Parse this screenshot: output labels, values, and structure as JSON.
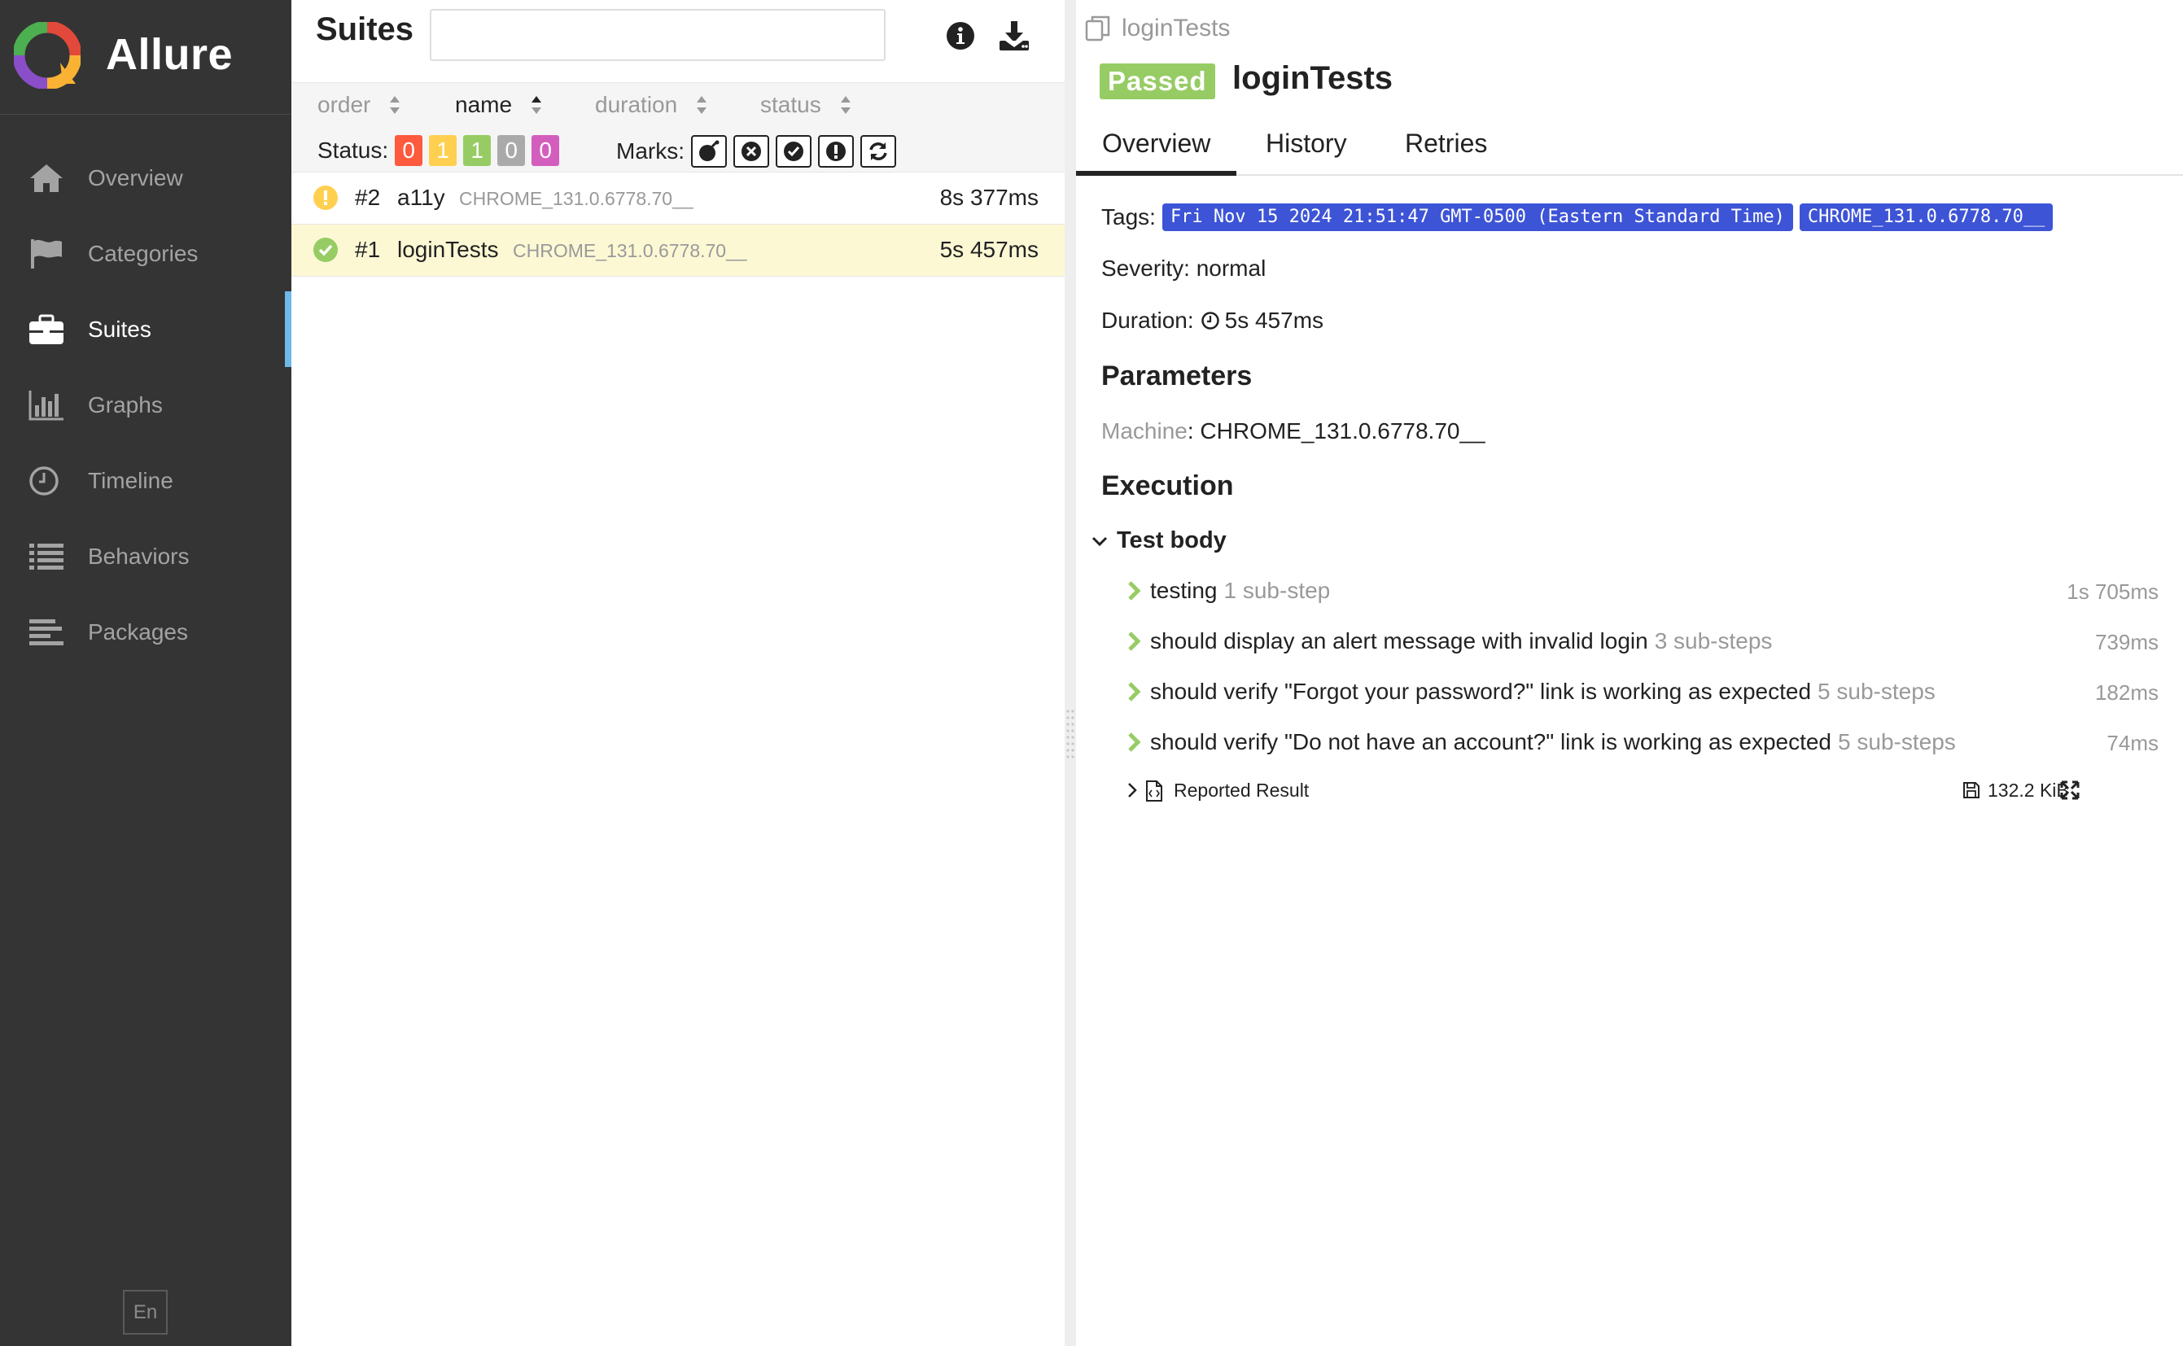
{
  "app": {
    "name": "Allure"
  },
  "sidebar": {
    "items": [
      {
        "label": "Overview",
        "icon": "home-icon"
      },
      {
        "label": "Categories",
        "icon": "flag-icon"
      },
      {
        "label": "Suites",
        "icon": "briefcase-icon",
        "active": true
      },
      {
        "label": "Graphs",
        "icon": "bar-chart-icon"
      },
      {
        "label": "Timeline",
        "icon": "clock-icon"
      },
      {
        "label": "Behaviors",
        "icon": "list-icon"
      },
      {
        "label": "Packages",
        "icon": "align-left-icon"
      }
    ],
    "language": "En"
  },
  "suites": {
    "title": "Suites",
    "search_value": "",
    "sort_columns": [
      {
        "label": "order",
        "active": false
      },
      {
        "label": "name",
        "active": true
      },
      {
        "label": "duration",
        "active": false
      },
      {
        "label": "status",
        "active": false
      }
    ],
    "status_label": "Status:",
    "status_counts": [
      {
        "status": "failed",
        "count": "0",
        "color": "#fd5a3e"
      },
      {
        "status": "broken",
        "count": "1",
        "color": "#ffd050"
      },
      {
        "status": "passed",
        "count": "1",
        "color": "#97cc64"
      },
      {
        "status": "skipped",
        "count": "0",
        "color": "#aaaaaa"
      },
      {
        "status": "unknown",
        "count": "0",
        "color": "#d35ebe"
      }
    ],
    "marks_label": "Marks:",
    "marks": [
      "bomb-icon",
      "times-circle-icon",
      "check-circle-icon",
      "exclamation-circle-icon",
      "refresh-icon"
    ],
    "rows": [
      {
        "order": "#2",
        "name": "a11y",
        "param": "CHROME_131.0.6778.70__",
        "duration": "8s 377ms",
        "status": "broken",
        "selected": false
      },
      {
        "order": "#1",
        "name": "loginTests",
        "param": "CHROME_131.0.6778.70__",
        "duration": "5s 457ms",
        "status": "passed",
        "selected": true
      }
    ]
  },
  "test": {
    "breadcrumb": "loginTests",
    "status": "Passed",
    "title": "loginTests",
    "tabs": [
      "Overview",
      "History",
      "Retries"
    ],
    "tags_label": "Tags:",
    "tags": [
      "Fri Nov 15 2024 21:51:47 GMT-0500 (Eastern Standard Time)",
      "CHROME_131.0.6778.70__"
    ],
    "severity": "Severity: normal",
    "duration_label": "Duration:",
    "duration": "5s 457ms",
    "parameters_heading": "Parameters",
    "param_key": "Machine",
    "param_value": ": CHROME_131.0.6778.70__",
    "execution_heading": "Execution",
    "test_body_label": "Test body",
    "steps": [
      {
        "name": "testing",
        "substeps": "1 sub-step",
        "duration": "1s 705ms"
      },
      {
        "name": "should display an alert message with invalid login",
        "substeps": "3 sub-steps",
        "duration": "739ms"
      },
      {
        "name": "should verify \"Forgot your password?\" link is working as expected",
        "substeps": "5 sub-steps",
        "duration": "182ms"
      },
      {
        "name": "should verify \"Do not have an account?\" link is working as expected",
        "substeps": "5 sub-steps",
        "duration": "74ms"
      }
    ],
    "attachment": {
      "label": "Reported Result",
      "size": "132.2 KiB"
    }
  },
  "colors": {
    "sidebar_bg": "#343434",
    "active_indicator": "#6eb8ea",
    "passed": "#97cc64",
    "broken": "#ffd050",
    "tag_bg": "#3d54d6",
    "selected_row": "#fcf8d4"
  }
}
